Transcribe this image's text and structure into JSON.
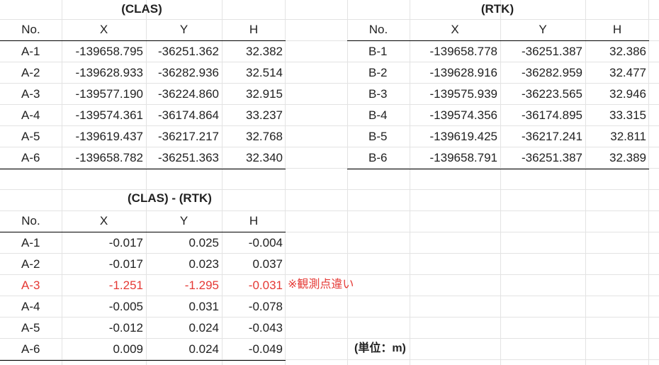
{
  "clas": {
    "title": "(CLAS)",
    "headers": [
      "No.",
      "X",
      "Y",
      "H"
    ],
    "rows": [
      [
        "A-1",
        "-139658.795",
        "-36251.362",
        "32.382"
      ],
      [
        "A-2",
        "-139628.933",
        "-36282.936",
        "32.514"
      ],
      [
        "A-3",
        "-139577.190",
        "-36224.860",
        "32.915"
      ],
      [
        "A-4",
        "-139574.361",
        "-36174.864",
        "33.237"
      ],
      [
        "A-5",
        "-139619.437",
        "-36217.217",
        "32.768"
      ],
      [
        "A-6",
        "-139658.782",
        "-36251.363",
        "32.340"
      ]
    ]
  },
  "rtk": {
    "title": "(RTK)",
    "headers": [
      "No.",
      "X",
      "Y",
      "H"
    ],
    "rows": [
      [
        "B-1",
        "-139658.778",
        "-36251.387",
        "32.386"
      ],
      [
        "B-2",
        "-139628.916",
        "-36282.959",
        "32.477"
      ],
      [
        "B-3",
        "-139575.939",
        "-36223.565",
        "32.946"
      ],
      [
        "B-4",
        "-139574.356",
        "-36174.895",
        "33.315"
      ],
      [
        "B-5",
        "-139619.425",
        "-36217.241",
        "32.811"
      ],
      [
        "B-6",
        "-139658.791",
        "-36251.387",
        "32.389"
      ]
    ]
  },
  "diff": {
    "title": "(CLAS) - (RTK)",
    "headers": [
      "No.",
      "X",
      "Y",
      "H"
    ],
    "rows": [
      [
        "A-1",
        "-0.017",
        "0.025",
        "-0.004"
      ],
      [
        "A-2",
        "-0.017",
        "0.023",
        "0.037"
      ],
      [
        "A-3",
        "-1.251",
        "-1.295",
        "-0.031"
      ],
      [
        "A-4",
        "-0.005",
        "0.031",
        "-0.078"
      ],
      [
        "A-5",
        "-0.012",
        "0.024",
        "-0.043"
      ],
      [
        "A-6",
        "0.009",
        "0.024",
        "-0.049"
      ]
    ],
    "note": "※観測点違い"
  },
  "unit_label": "(単位：m)",
  "colors": {
    "highlight": "#e53935",
    "gridline": "#e3e3e3",
    "border": "#000000"
  }
}
